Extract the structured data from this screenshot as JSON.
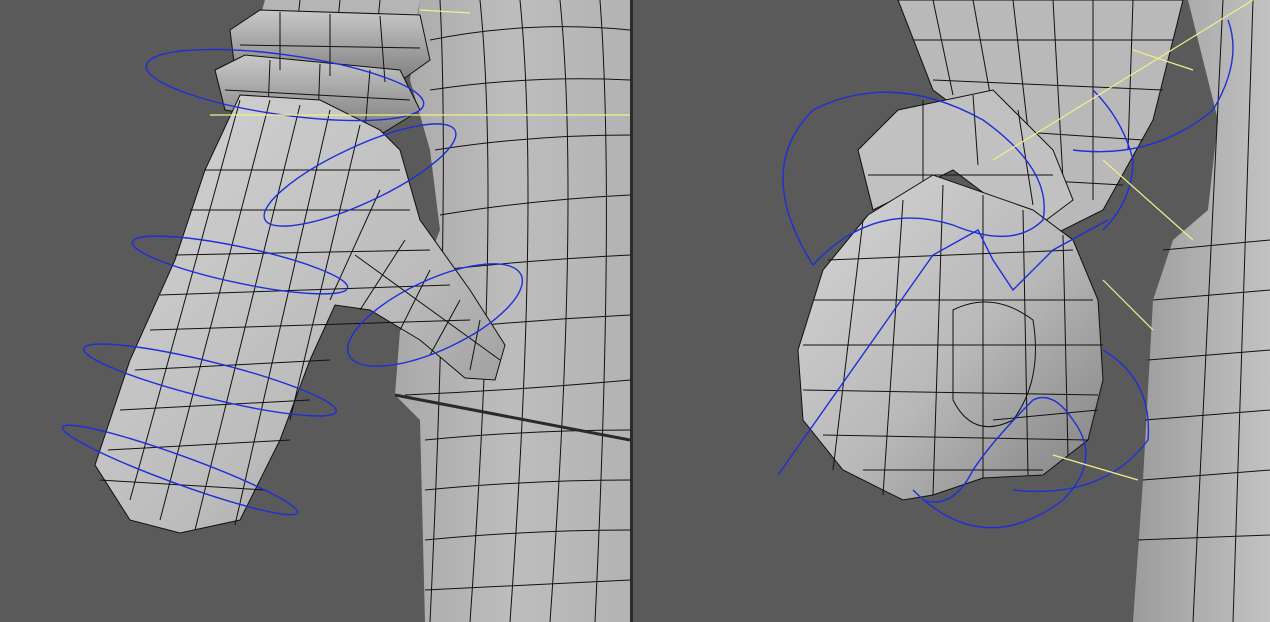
{
  "colors": {
    "background": "#5a5a5a",
    "mesh_light": "#c9c9c9",
    "mesh_dark": "#8a8a8a",
    "wireframe": "#111111",
    "control_curve": "#1f2fd8",
    "joint_line": "#f2ef8a",
    "divider": "#2b2b2b"
  },
  "viewports": [
    {
      "id": "left",
      "subject": "open-hand-pointing-mesh"
    },
    {
      "id": "right",
      "subject": "closed-fist-mesh"
    }
  ]
}
